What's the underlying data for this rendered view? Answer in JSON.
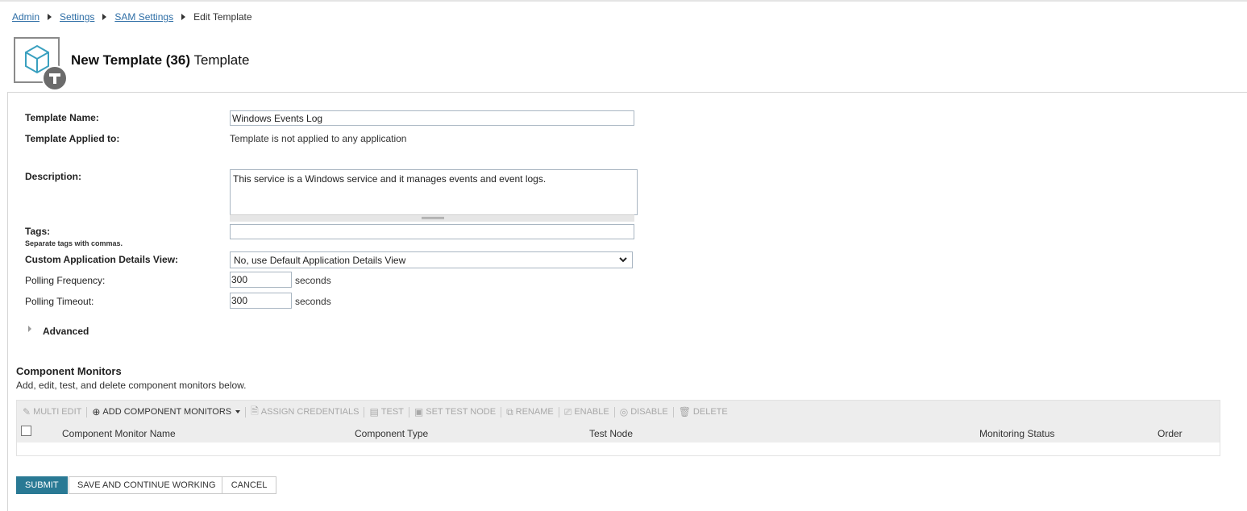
{
  "breadcrumb": {
    "items": [
      "Admin",
      "Settings",
      "SAM Settings"
    ],
    "current": "Edit Template"
  },
  "header": {
    "title_bold": "New Template (36)",
    "title_rest": "Template",
    "icon": "template-cube-icon"
  },
  "form": {
    "template_name_label": "Template Name:",
    "template_name_value": "Windows Events Log",
    "applied_label": "Template Applied to:",
    "applied_value": "Template is not applied to any application",
    "description_label": "Description:",
    "description_value": "This service is a Windows service and it manages events and event logs.",
    "tags_label": "Tags:",
    "tags_hint": "Separate tags with commas.",
    "tags_value": "",
    "details_view_label": "Custom Application Details View:",
    "details_view_value": "No, use Default Application Details View",
    "polling_frequency_label": "Polling Frequency:",
    "polling_frequency_value": "300",
    "polling_timeout_label": "Polling Timeout:",
    "polling_timeout_value": "300",
    "unit": "seconds",
    "advanced_label": "Advanced"
  },
  "component_monitors": {
    "title": "Component Monitors",
    "subtitle": "Add, edit, test, and delete component monitors below.",
    "toolbar": {
      "multi_edit": "MULTI EDIT",
      "add": "ADD COMPONENT MONITORS",
      "assign_credentials": "ASSIGN CREDENTIALS",
      "test": "TEST",
      "set_test_node": "SET TEST NODE",
      "rename": "RENAME",
      "enable": "ENABLE",
      "disable": "DISABLE",
      "delete": "DELETE"
    },
    "columns": {
      "name": "Component Monitor Name",
      "type": "Component Type",
      "test_node": "Test Node",
      "status": "Monitoring Status",
      "order": "Order"
    }
  },
  "actions": {
    "submit": "SUBMIT",
    "save_continue": "SAVE AND CONTINUE WORKING",
    "cancel": "CANCEL"
  },
  "colors": {
    "link": "#2e6ea6",
    "primary_button": "#297994",
    "toolbar_bg": "#ededed"
  }
}
